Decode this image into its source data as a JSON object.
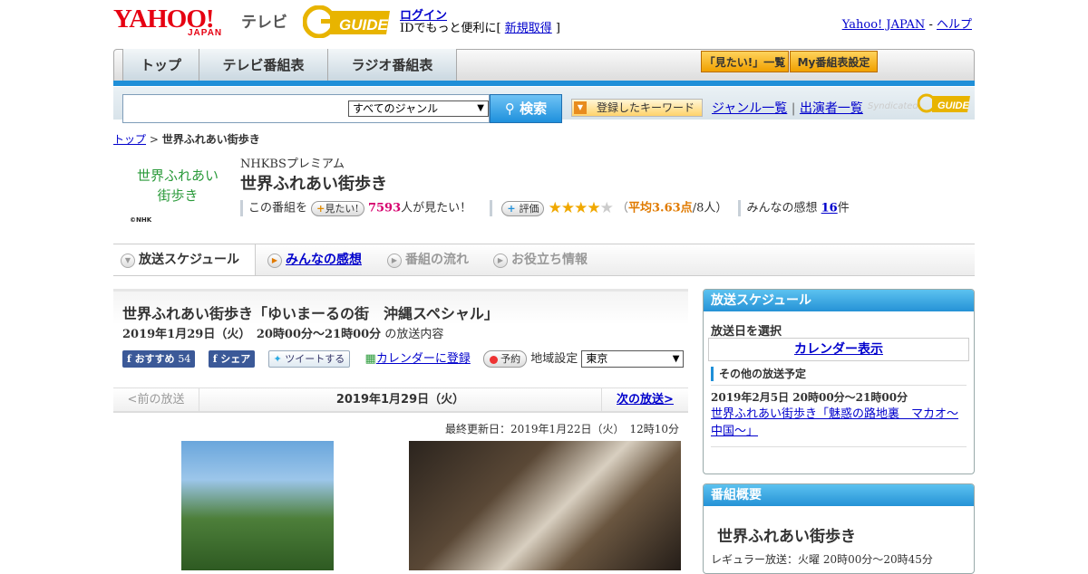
{
  "header": {
    "yahoo_logo": "YAHOO!",
    "yahoo_japan": "JAPAN",
    "tv_label": "テレビ",
    "gguide_logo": "G-GUIDE",
    "login": "ログイン",
    "login_sub_prefix": "IDでもっと便利に[ ",
    "register": "新規取得",
    "login_sub_suffix": " ]",
    "yahoo_japan_link": "Yahoo! JAPAN",
    "separator": " - ",
    "help_link": "ヘルプ"
  },
  "nav": {
    "tabs": [
      "トップ",
      "テレビ番組表",
      "ラジオ番組表"
    ],
    "mitai_list": "「見たい!」一覧",
    "my_program": "My番組表設定"
  },
  "search": {
    "genre_selected": "すべてのジャンル",
    "search_button": "検索",
    "keyword_button": "登録したキーワード",
    "genre_list": "ジャンル一覧",
    "divider": " | ",
    "performer_list": "出演者一覧",
    "syndicated": "Syndicated",
    "syndicated_logo": "G-GUIDE"
  },
  "breadcrumb": {
    "top": "トップ",
    "sep": " > ",
    "current": "世界ふれあい街歩き"
  },
  "program": {
    "logo_line1": "世界ふれあい",
    "logo_line2": "街歩き",
    "nhk_mark": "©NHK",
    "channel": "NHKBSプレミアム",
    "title": "世界ふれあい街歩き",
    "mitai_prefix": "この番組を",
    "mitai_button": "見たい!",
    "mitai_count": "7593",
    "mitai_suffix": "人が見たい！",
    "rate_button": "評価",
    "rating": 3.63,
    "rating_open": "（",
    "rating_avg": "平均3.63点",
    "rating_people": "/8人）",
    "comments_label": "みんなの感想",
    "comments_count": "16",
    "comments_unit": "件"
  },
  "tabs": [
    "放送スケジュール",
    "みんなの感想",
    "番組の流れ",
    "お役立ち情報"
  ],
  "episode": {
    "title": "世界ふれあい街歩き「ゆいまーるの街　沖縄スペシャル」",
    "date": "2019年1月29日（火）　20時00分～21時00分",
    "date_suffix": "の放送内容",
    "fb_recommend": "おすすめ",
    "fb_count": "54",
    "fb_share": "シェア",
    "tweet": "ツイートする",
    "calendar": "カレンダーに登録",
    "reserve": "予約",
    "region_label": "地域設定",
    "region": "東京",
    "prev": "<前の放送",
    "current_date": "2019年1月29日（火）",
    "next": "次の放送>",
    "updated": "最終更新日：2019年1月22日（火）　12時10分"
  },
  "sidebar": {
    "schedule_head": "放送スケジュール",
    "select_date": "放送日を選択",
    "calendar": "カレンダー表示",
    "other_head": "その他の放送予定",
    "other_date": "2019年2月5日  20時00分～21時00分",
    "other_link": "世界ふれあい街歩き「魅惑の路地裏　マカオ～中国～」",
    "overview_head": "番組概要",
    "overview_title": "世界ふれあい街歩き",
    "regular": "レギュラー放送：火曜 20時00分～20時45分"
  },
  "colors": {
    "brand_red": "#e60012",
    "nav_blue": "#1f8fd8",
    "accent_orange": "#f0a000",
    "mitai_pink": "#d6006e",
    "rating_orange": "#e07a00"
  }
}
